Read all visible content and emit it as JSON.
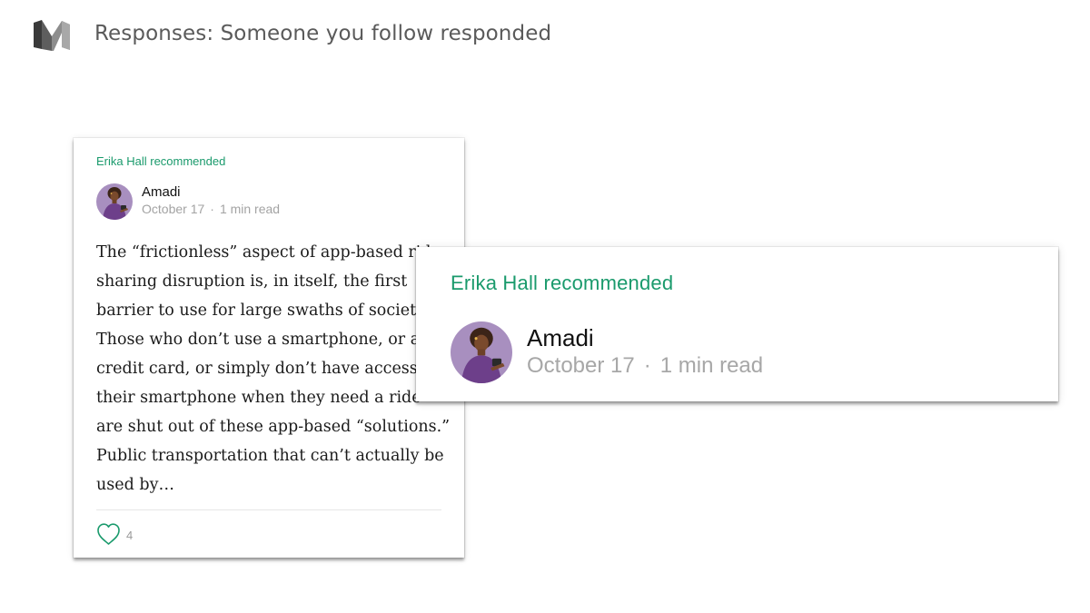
{
  "header": {
    "logo_icon": "medium-logo-icon",
    "title": "Responses: Someone you follow responded"
  },
  "card_left": {
    "recommended_label": "Erika Hall recommended",
    "author": {
      "name": "Amadi",
      "avatar_icon": "avatar-illustration-icon"
    },
    "date": "October 17",
    "separator": "·",
    "read_time": "1 min read",
    "excerpt_lines": [
      "The “frictionless” aspect of app-based ride",
      "sharing disruption is, in itself, the first",
      "barrier to use for large swaths of society.",
      "Those who don’t use a smartphone, or a",
      "credit card, or simply don’t have access to",
      "their smartphone when they need a ride",
      "are shut out of these app-based “solutions.”",
      "Public transportation that can’t actually be",
      "used by…"
    ],
    "like_icon": "heart-outline-icon",
    "like_count": "4"
  },
  "card_right": {
    "recommended_label": "Erika Hall recommended",
    "author": {
      "name": "Amadi",
      "avatar_icon": "avatar-illustration-icon"
    },
    "date": "October 17",
    "separator": "·",
    "read_time": "1 min read"
  },
  "colors": {
    "accent_green": "#1a9a6c",
    "meta_gray": "#a3a3a3",
    "header_gray": "#5a5a5a",
    "avatar_bg": "#a88fbf"
  }
}
